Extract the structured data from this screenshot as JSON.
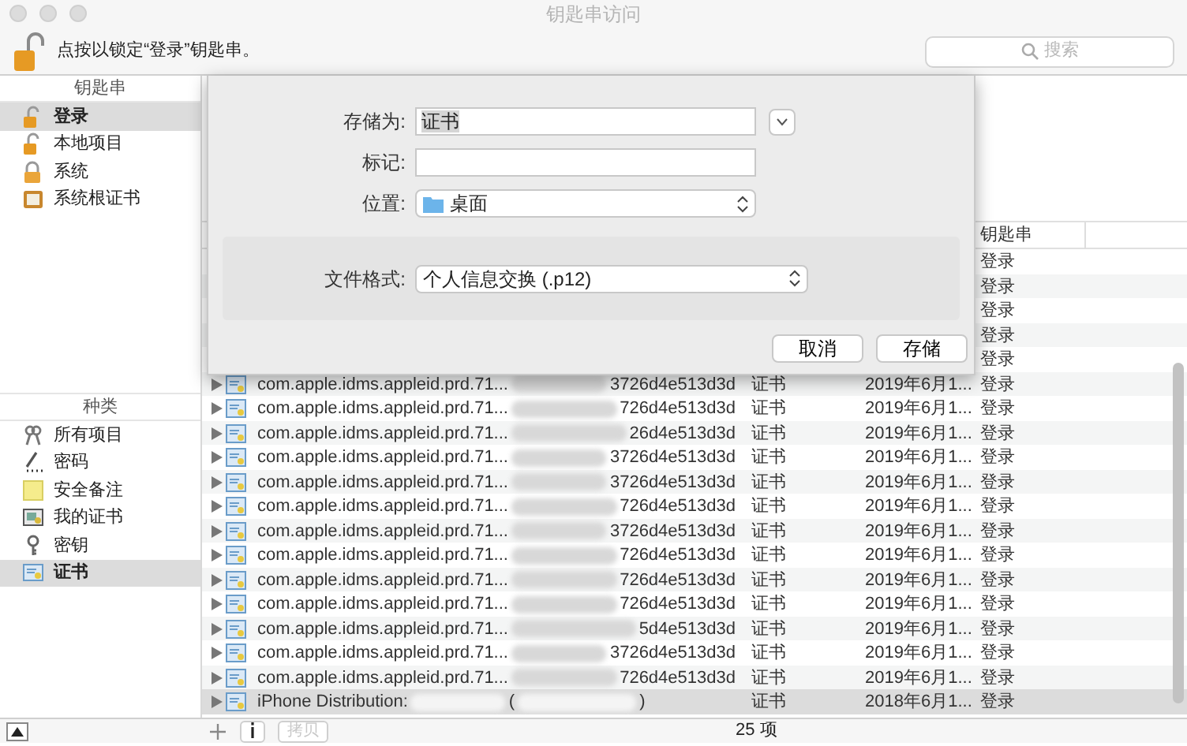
{
  "window": {
    "title": "钥匙串访问"
  },
  "toolbar": {
    "lock_message": "点按以锁定“登录”钥匙串。",
    "search": {
      "placeholder": "搜索"
    }
  },
  "sidebar": {
    "keychains": {
      "header": "钥匙串",
      "items": [
        {
          "label": "登录",
          "selected": true
        },
        {
          "label": "本地项目",
          "selected": false
        },
        {
          "label": "系统",
          "selected": false
        },
        {
          "label": "系统根证书",
          "selected": false
        }
      ]
    },
    "categories": {
      "header": "种类",
      "items": [
        {
          "label": "所有项目",
          "selected": false
        },
        {
          "label": "密码",
          "selected": false
        },
        {
          "label": "安全备注",
          "selected": false
        },
        {
          "label": "我的证书",
          "selected": false
        },
        {
          "label": "密钥",
          "selected": false
        },
        {
          "label": "证书",
          "selected": true
        }
      ]
    }
  },
  "table": {
    "columns": [
      {
        "label": "钥匙串"
      }
    ],
    "rows": [
      {
        "keychain": "登录",
        "selected": false
      },
      {
        "keychain": "登录",
        "selected": false
      },
      {
        "keychain": "登录",
        "selected": false
      },
      {
        "keychain": "登录",
        "selected": false
      },
      {
        "keychain": "登录",
        "selected": false
      },
      {
        "name_parts": [
          "com.apple.idms.appleid.prd.71...",
          "3726d4e513d3d"
        ],
        "kind": "证书",
        "date": "2019年6月1...",
        "keychain": "登录",
        "selected": false
      },
      {
        "name_parts": [
          "com.apple.idms.appleid.prd.71...",
          "726d4e513d3d"
        ],
        "kind": "证书",
        "date": "2019年6月1...",
        "keychain": "登录",
        "selected": false
      },
      {
        "name_parts": [
          "com.apple.idms.appleid.prd.71...",
          "26d4e513d3d"
        ],
        "kind": "证书",
        "date": "2019年6月1...",
        "keychain": "登录",
        "selected": false
      },
      {
        "name_parts": [
          "com.apple.idms.appleid.prd.71...",
          "3726d4e513d3d"
        ],
        "kind": "证书",
        "date": "2019年6月1...",
        "keychain": "登录",
        "selected": false
      },
      {
        "name_parts": [
          "com.apple.idms.appleid.prd.71...",
          "3726d4e513d3d"
        ],
        "kind": "证书",
        "date": "2019年6月1...",
        "keychain": "登录",
        "selected": false
      },
      {
        "name_parts": [
          "com.apple.idms.appleid.prd.71...",
          "726d4e513d3d"
        ],
        "kind": "证书",
        "date": "2019年6月1...",
        "keychain": "登录",
        "selected": false
      },
      {
        "name_parts": [
          "com.apple.idms.appleid.prd.71...",
          "3726d4e513d3d"
        ],
        "kind": "证书",
        "date": "2019年6月1...",
        "keychain": "登录",
        "selected": false
      },
      {
        "name_parts": [
          "com.apple.idms.appleid.prd.71...",
          "726d4e513d3d"
        ],
        "kind": "证书",
        "date": "2019年6月1...",
        "keychain": "登录",
        "selected": false
      },
      {
        "name_parts": [
          "com.apple.idms.appleid.prd.71...",
          "726d4e513d3d"
        ],
        "kind": "证书",
        "date": "2019年6月1...",
        "keychain": "登录",
        "selected": false
      },
      {
        "name_parts": [
          "com.apple.idms.appleid.prd.71...",
          "726d4e513d3d"
        ],
        "kind": "证书",
        "date": "2019年6月1...",
        "keychain": "登录",
        "selected": false
      },
      {
        "name_parts": [
          "com.apple.idms.appleid.prd.71...",
          "5d4e513d3d"
        ],
        "kind": "证书",
        "date": "2019年6月1...",
        "keychain": "登录",
        "selected": false
      },
      {
        "name_parts": [
          "com.apple.idms.appleid.prd.71...",
          "3726d4e513d3d"
        ],
        "kind": "证书",
        "date": "2019年6月1...",
        "keychain": "登录",
        "selected": false
      },
      {
        "name_parts": [
          "com.apple.idms.appleid.prd.71...",
          "726d4e513d3d"
        ],
        "kind": "证书",
        "date": "2019年6月1...",
        "keychain": "登录",
        "selected": false
      },
      {
        "name_parts": [
          "iPhone Distribution:",
          "(",
          ")"
        ],
        "kind": "证书",
        "date": "2018年6月1...",
        "keychain": "登录",
        "selected": true
      }
    ]
  },
  "save_dialog": {
    "fields": [
      {
        "kind": "text",
        "label": "存储为:",
        "value": "证书",
        "text_selected": true
      },
      {
        "kind": "text",
        "label": "标记:"
      },
      {
        "kind": "popup",
        "label": "位置:",
        "value": "桌面"
      }
    ],
    "format": {
      "label": "文件格式:",
      "value": "个人信息交换 (.p12)"
    },
    "buttons": [
      "取消",
      "存储"
    ]
  },
  "bottom_bar": {
    "buttons": [
      "拷贝"
    ],
    "count": "25 项"
  }
}
